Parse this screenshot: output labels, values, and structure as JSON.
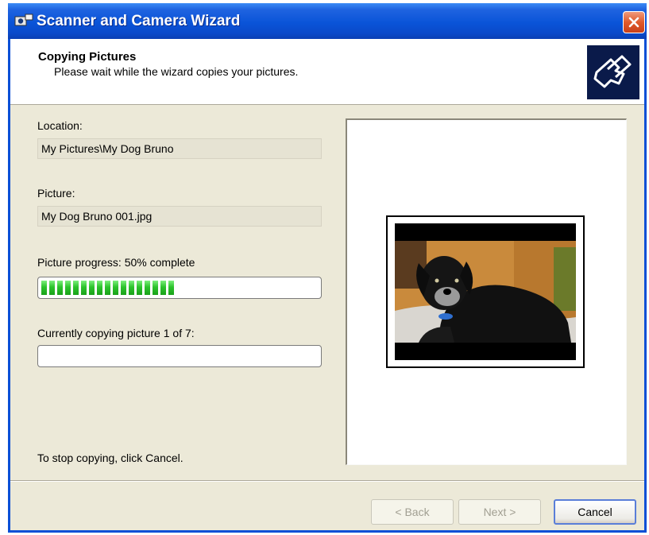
{
  "window": {
    "title": "Scanner and Camera Wizard"
  },
  "header": {
    "title": "Copying Pictures",
    "subtitle": "Please wait while the wizard copies your pictures."
  },
  "location": {
    "label": "Location:",
    "value": "My Pictures\\My Dog Bruno"
  },
  "picture": {
    "label": "Picture:",
    "value": "My Dog Bruno 001.jpg"
  },
  "picture_progress": {
    "label": "Picture progress: 50% complete",
    "percent": 50
  },
  "overall_progress": {
    "label": "Currently copying picture 1 of 7:",
    "percent": 0
  },
  "footer_hint": "To stop copying, click Cancel.",
  "buttons": {
    "back": "< Back",
    "next": "Next >",
    "cancel": "Cancel"
  },
  "colors": {
    "titlebar": "#0a54d8",
    "progress": "#2cc32c",
    "window_bg": "#ece9d8"
  },
  "icons": {
    "title": "scanner-camera-icon",
    "close": "close-icon",
    "header_logo": "camera-wizard-logo-icon"
  }
}
